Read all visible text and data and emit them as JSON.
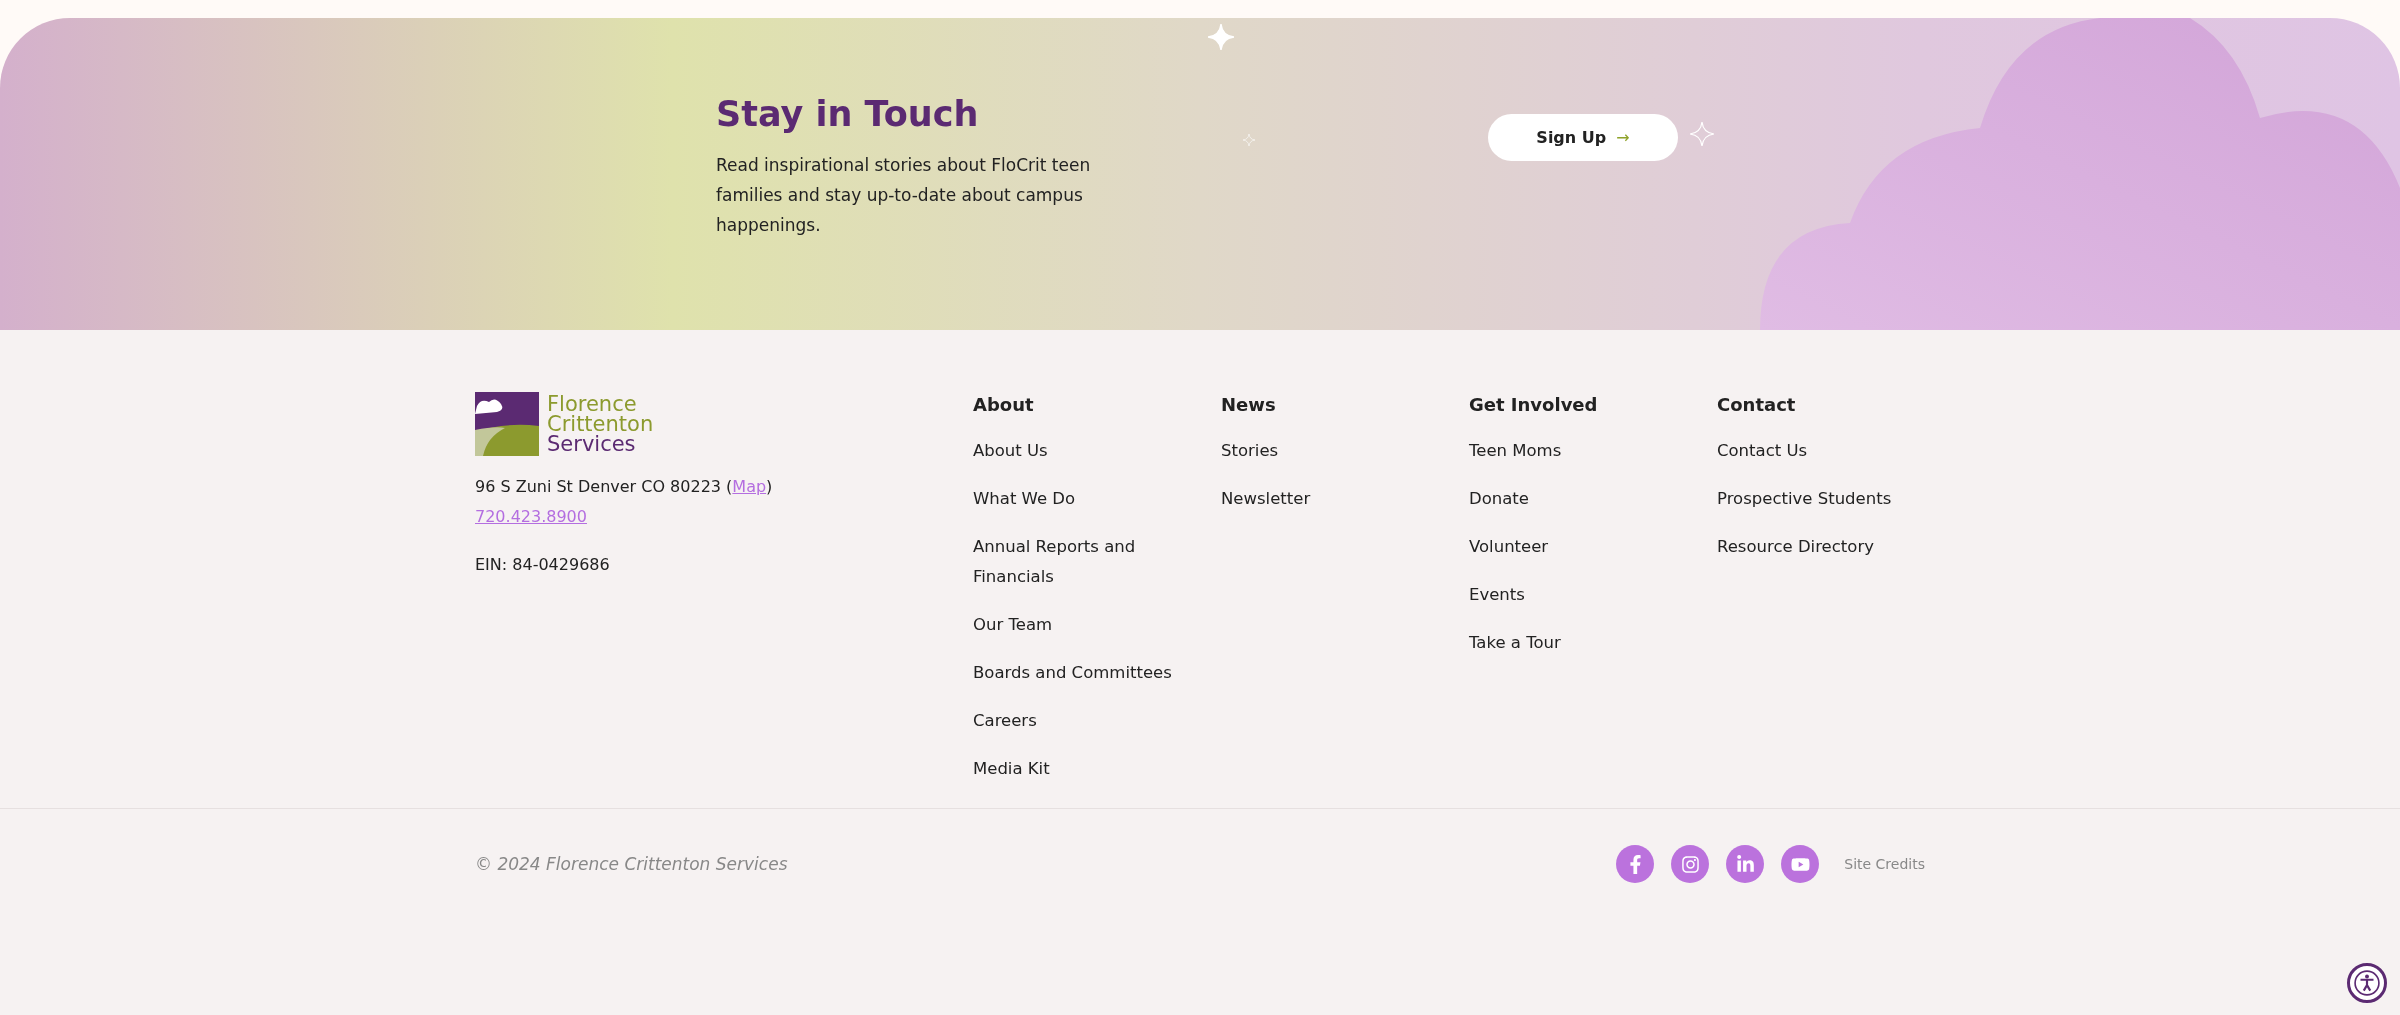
{
  "signup": {
    "title": "Stay in Touch",
    "text": "Read inspirational stories about FloCrit teen families and stay up-to-date about campus happenings.",
    "button": "Sign Up",
    "button_icon": "→"
  },
  "footer": {
    "logo": [
      "Florence",
      "Crittenton",
      "Services"
    ],
    "address": "96 S Zuni St Denver CO 80223 (",
    "map_link": "Map",
    "address_end": ")",
    "phone": "720.423.8900",
    "ein": "EIN: 84-0429686",
    "columns": [
      {
        "heading": "About",
        "links": [
          "About Us",
          "What We Do",
          "Annual Reports and Financials",
          "Our Team",
          "Boards and Committees",
          "Careers",
          "Media Kit"
        ]
      },
      {
        "heading": "News",
        "links": [
          "Stories",
          "Newsletter"
        ]
      },
      {
        "heading": "Get Involved",
        "links": [
          "Teen Moms",
          "Donate",
          "Volunteer",
          "Events",
          "Take a Tour"
        ]
      },
      {
        "heading": "Contact",
        "links": [
          "Contact Us",
          "Prospective Students",
          "Resource Directory"
        ]
      }
    ]
  },
  "bottom": {
    "copyright": "© 2024 Florence Crittenton Services",
    "social": [
      {
        "kind": "facebook"
      },
      {
        "kind": "instagram"
      },
      {
        "kind": "linkedin"
      },
      {
        "kind": "youtube"
      }
    ],
    "credits": "Site Credits"
  }
}
